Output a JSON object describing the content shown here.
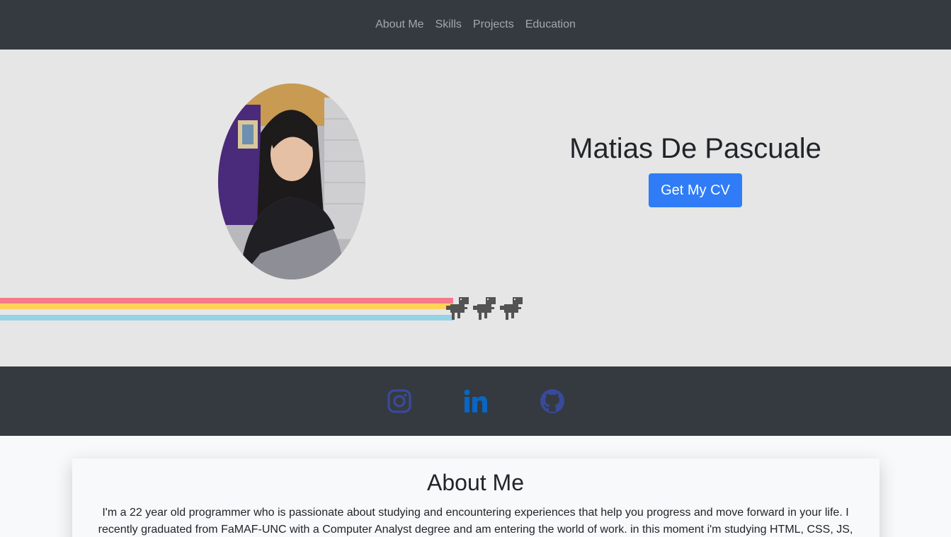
{
  "nav": {
    "links": [
      "About Me",
      "Skills",
      "Projects",
      "Education"
    ]
  },
  "hero": {
    "name": "Matias De Pascuale",
    "cv_button": "Get My CV",
    "rainbow_colors": [
      "#f47b8a",
      "#ffd25a",
      "#93d3e6"
    ]
  },
  "social": {
    "items": [
      {
        "name": "instagram-icon",
        "color": "#3a4a9a"
      },
      {
        "name": "linkedin-icon",
        "color": "#0a66c2"
      },
      {
        "name": "github-icon",
        "color": "#3a4a9a"
      }
    ]
  },
  "about": {
    "title": "About Me",
    "text": "I'm a 22 year old programmer who is passionate about studying and encountering experiences that help you progress and move forward in your life. I recently graduated from FaMAF-UNC with a Computer Analyst degree and am entering the world of work. in this moment i'm studying HTML, CSS, JS,"
  },
  "colors": {
    "navbar_bg": "#343a40",
    "hero_bg": "#e6e6e6",
    "accent": "#2f7cf6"
  }
}
